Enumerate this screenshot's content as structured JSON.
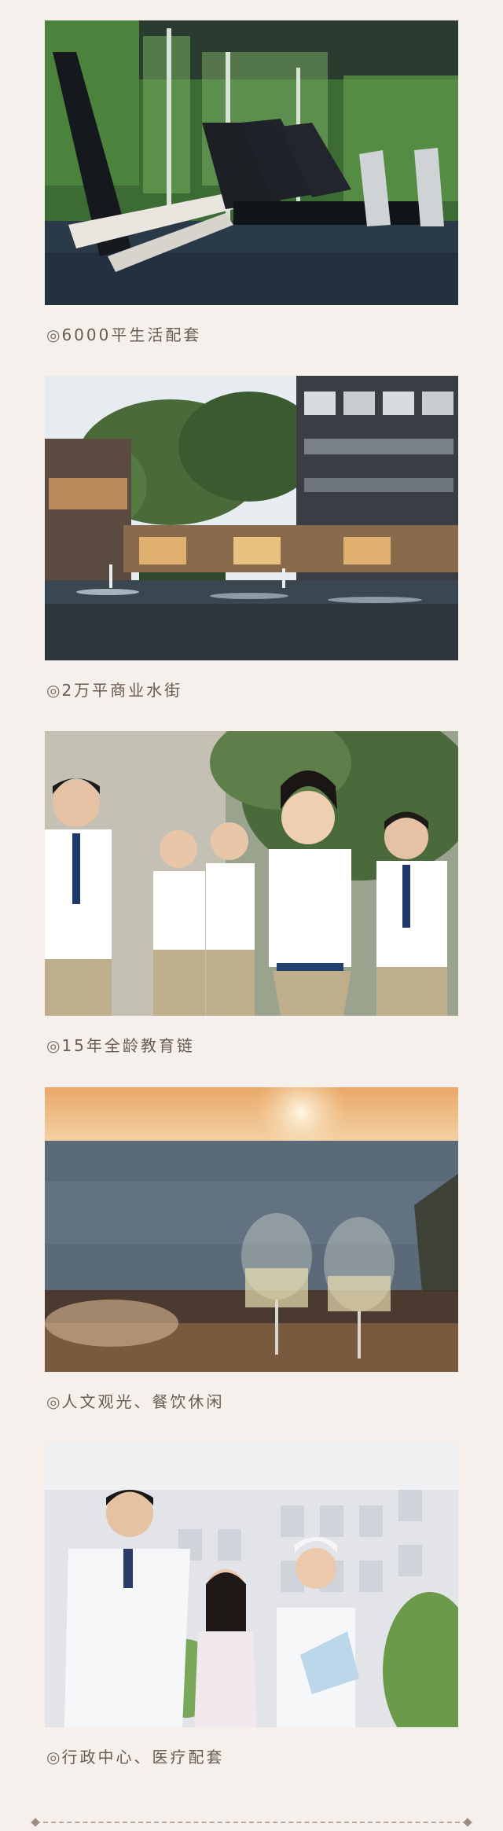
{
  "items": [
    {
      "mark": "◎",
      "caption": "6000平生活配套",
      "scene": "gym"
    },
    {
      "mark": "◎",
      "caption": "2万平商业水街",
      "scene": "street"
    },
    {
      "mark": "◎",
      "caption": "15年全龄教育链",
      "scene": "school"
    },
    {
      "mark": "◎",
      "caption": "人文观光、餐饮休闲",
      "scene": "sunset"
    },
    {
      "mark": "◎",
      "caption": "行政中心、医疗配套",
      "scene": "medical"
    }
  ],
  "colors": {
    "background": "#f5f0ec",
    "caption_text": "#6b5a50",
    "divider": "#b8a89c"
  }
}
